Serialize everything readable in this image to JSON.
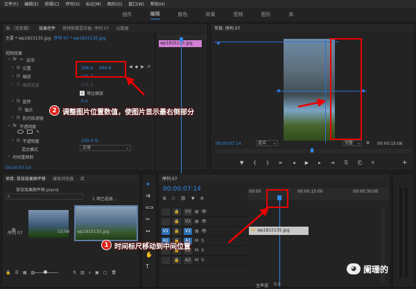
{
  "menu": [
    "文件(F)",
    "编辑(E)",
    "剪辑(C)",
    "序列(S)",
    "标记(M)",
    "图形(G)",
    "窗口(W)",
    "帮助(H)"
  ],
  "workspaces": [
    {
      "label": "组件",
      "active": false
    },
    {
      "label": "编辑",
      "active": true
    },
    {
      "label": "颜色",
      "active": false
    },
    {
      "label": "效果",
      "active": false
    },
    {
      "label": "音频",
      "active": false
    },
    {
      "label": "图形",
      "active": false
    },
    {
      "label": "库",
      "active": false
    }
  ],
  "effect_panel": {
    "tabs": [
      "源:（无剪辑）",
      "效果控件",
      "音频剪辑混合器: 序列 07",
      "元数据"
    ],
    "source": "主要 * wp1815135.jpg",
    "sequence": "序列 07 * wp1815135.jpg",
    "clip_label": "wp1815135.jpg",
    "video_effects": "视频效果",
    "motion": "运动",
    "position_label": "位置",
    "position_x": "306.6",
    "position_y": "664.9",
    "scale_label": "缩放",
    "scale_value": "141.2",
    "scale_width_label": "缩放宽度",
    "scale_width_value": "141.2",
    "uniform_scale": "等比缩放",
    "rotation_label": "旋转",
    "rotation_value": "0.0",
    "anchor_label": "锚点",
    "flicker_label": "防闪烁滤镜",
    "opacity_section": "不透明度",
    "opacity_label": "不透明度",
    "opacity_value": "100.0 %",
    "blend_label": "混合模式",
    "blend_value": "正常",
    "time_remap": "时间重映射",
    "timecode": "00:00:07:14"
  },
  "program_monitor": {
    "title": "节目: 序列 07",
    "timecode": "00:00:07:14",
    "fit": "适合",
    "quality": "完整",
    "duration": "00:00:15:06"
  },
  "project_panel": {
    "tabs": [
      "项目: 单张效果图平移",
      "媒体浏览器",
      "库"
    ],
    "file": "单张效果图平移.prproj",
    "selection": "1 项已选择…",
    "items": [
      {
        "name": "序列 07",
        "duration": "15:06"
      },
      {
        "name": "wp1815135.jpg",
        "duration": ""
      }
    ]
  },
  "timeline": {
    "title": "序列 07",
    "timecode": "00:00:07:14",
    "ruler_labels": [
      "00:00",
      "00:00:15:00",
      "00:00:30:00"
    ],
    "tracks": [
      "V3",
      "V2",
      "V1",
      "A1",
      "A2",
      "A3"
    ],
    "clip_label": "wp1815135.jpg",
    "master": "主声道",
    "master_value": "0.0"
  },
  "annotations": {
    "callout1_num": "1",
    "callout1": "时间标尺移动到中间位置",
    "callout2_num": "2",
    "callout2": "调整图片位置数值，使图片显示最右侧部分"
  },
  "watermark": "阑珊的"
}
